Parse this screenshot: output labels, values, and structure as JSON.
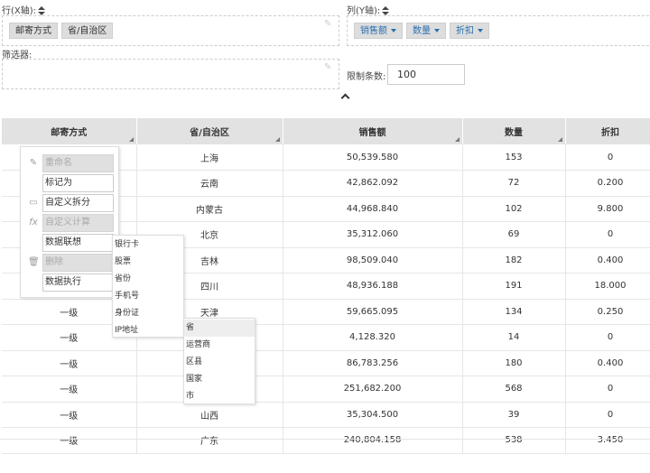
{
  "row_axis": {
    "label": "行(X轴):",
    "chips": [
      "邮寄方式",
      "省/自治区"
    ]
  },
  "col_axis": {
    "label": "列(Y轴):",
    "chips": [
      "销售额",
      "数量",
      "折扣"
    ]
  },
  "filter": {
    "label": "筛选器:"
  },
  "limit": {
    "label": "限制条数:",
    "value": "100"
  },
  "table": {
    "headers": [
      "邮寄方式",
      "省/自治区",
      "销售额",
      "数量",
      "折扣"
    ],
    "rows": [
      [
        "",
        "上海",
        "50,539.580",
        "153",
        "0"
      ],
      [
        "",
        "云南",
        "42,862.092",
        "72",
        "0.200"
      ],
      [
        "",
        "内蒙古",
        "44,968.840",
        "102",
        "9.800"
      ],
      [
        "",
        "北京",
        "35,312.060",
        "69",
        "0"
      ],
      [
        "",
        "吉林",
        "98,509.040",
        "182",
        "0.400"
      ],
      [
        "",
        "四川",
        "48,936.188",
        "191",
        "18.000"
      ],
      [
        "一级",
        "天津",
        "59,665.095",
        "134",
        "0.250"
      ],
      [
        "一级",
        "",
        "4,128.320",
        "14",
        "0"
      ],
      [
        "一级",
        "",
        "86,783.256",
        "180",
        "0.400"
      ],
      [
        "一级",
        "",
        "251,682.200",
        "568",
        "0"
      ],
      [
        "一级",
        "山西",
        "35,304.500",
        "39",
        "0"
      ],
      [
        "一级",
        "广东",
        "240,804.158",
        "538",
        "3.450"
      ]
    ]
  },
  "context_menu": {
    "items": [
      "重命名",
      "标记为",
      "自定义拆分",
      "自定义计算",
      "数据联想",
      "删除",
      "数据执行"
    ],
    "icons": [
      "pencil-icon",
      "",
      "split-icon",
      "fx-icon",
      "",
      "trash-icon",
      ""
    ]
  },
  "submenu_datatype": {
    "items": [
      "银行卡",
      "股票",
      "省份",
      "手机号",
      "身份证",
      "IP地址"
    ]
  },
  "submenu_ip": {
    "items": [
      "省",
      "运营商",
      "区县",
      "国家",
      "市"
    ]
  }
}
